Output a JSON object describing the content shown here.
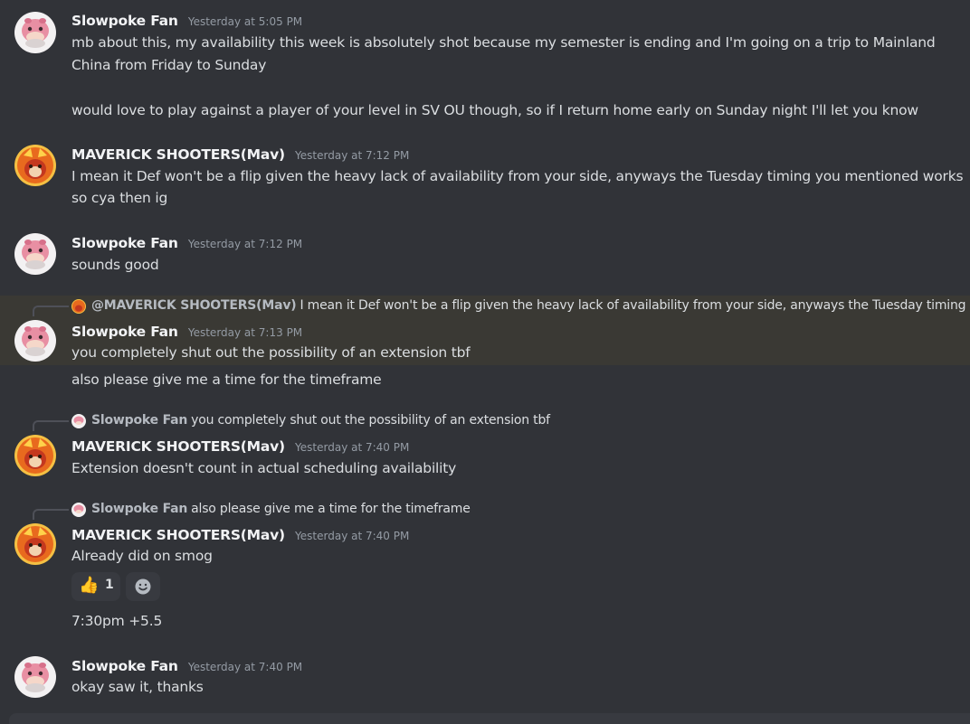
{
  "messages": [
    {
      "author": "Slowpoke Fan",
      "timestamp": "Yesterday at 5:05 PM",
      "lines": [
        "mb about this, my availability this week is absolutely shot because my semester is ending and I'm going on a trip to Mainland",
        "China from Friday to Sunday",
        "would love to play against a player of your level in SV OU though, so if I return home early on Sunday night I'll let you know"
      ]
    },
    {
      "author": "MAVERICK SHOOTERS(Mav)",
      "timestamp": "Yesterday at 7:12 PM",
      "lines": [
        "I mean it Def won't be a flip given the heavy lack of availability from your side, anyways the Tuesday timing you mentioned works",
        "so cya then ig"
      ]
    },
    {
      "author": "Slowpoke Fan",
      "timestamp": "Yesterday at 7:12 PM",
      "lines": [
        "sounds good"
      ]
    },
    {
      "reply": {
        "name": "@MAVERICK SHOOTERS(Mav)",
        "text": "I mean it Def won't be a flip given the heavy lack of availability from your side, anyways the Tuesday timing you ..."
      },
      "author": "Slowpoke Fan",
      "timestamp": "Yesterday at 7:13 PM",
      "lines": [
        "you completely shut out the possibility of an extension tbf"
      ],
      "followup": "also please give me a time for the timeframe"
    },
    {
      "reply": {
        "name": "Slowpoke Fan",
        "text": "you completely shut out the possibility of an extension tbf"
      },
      "author": "MAVERICK SHOOTERS(Mav)",
      "timestamp": "Yesterday at 7:40 PM",
      "lines": [
        "Extension doesn't count in actual scheduling availability"
      ]
    },
    {
      "reply": {
        "name": "Slowpoke Fan",
        "text": "also please give me a time for the timeframe"
      },
      "author": "MAVERICK SHOOTERS(Mav)",
      "timestamp": "Yesterday at 7:40 PM",
      "lines": [
        "Already did on smog"
      ],
      "reactions": [
        {
          "emoji": "👍",
          "icon": "thumbs-up-icon",
          "count": "1"
        },
        {
          "icon": "add-reaction-icon"
        }
      ],
      "followup": "7:30pm +5.5"
    },
    {
      "author": "Slowpoke Fan",
      "timestamp": "Yesterday at 7:40 PM",
      "lines": [
        "okay saw it, thanks"
      ]
    }
  ],
  "colors": {
    "background": "#313338",
    "highlight": "#3a3934",
    "username": "#f2f3f5",
    "timestamp": "#949ba4",
    "text": "#dbdee1"
  }
}
